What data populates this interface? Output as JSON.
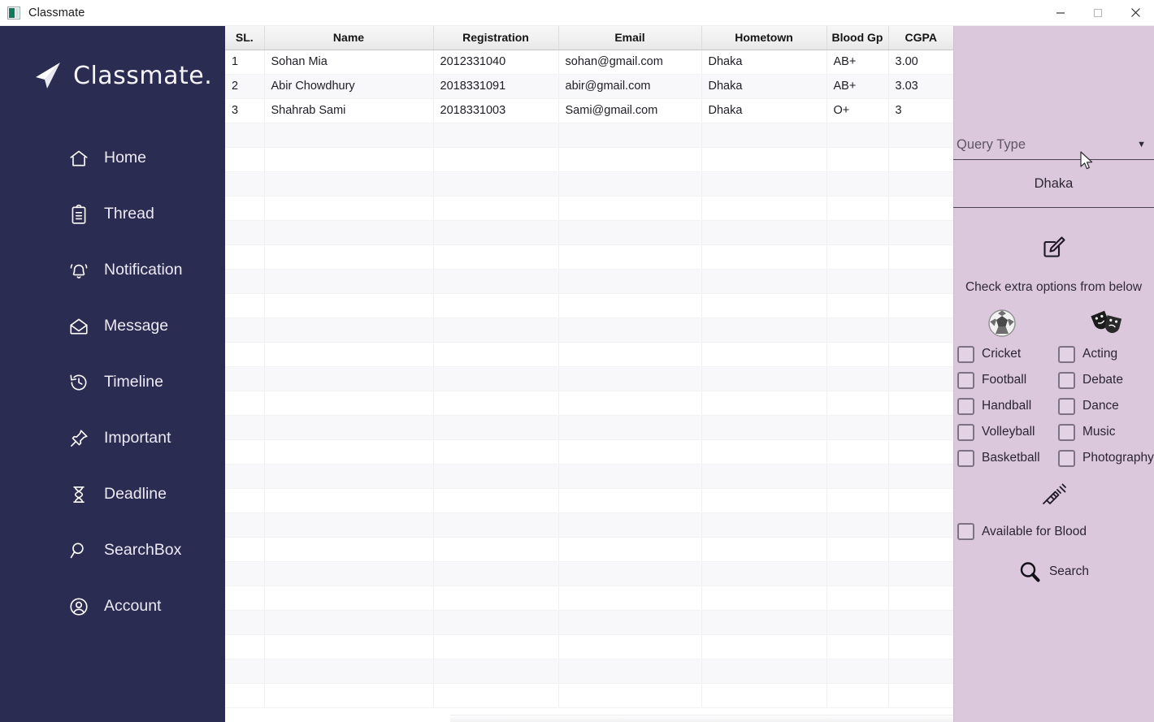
{
  "window": {
    "title": "Classmate",
    "icon": "app-icon",
    "controls": {
      "minimize": "minimize",
      "maximize": "maximize",
      "close": "close"
    }
  },
  "brand": {
    "name": "Classmate.",
    "icon": "paper-plane-icon"
  },
  "sidebar": {
    "background": "#2b2c52",
    "items": [
      {
        "label": "Home",
        "icon": "home-icon"
      },
      {
        "label": "Thread",
        "icon": "clipboard-icon"
      },
      {
        "label": "Notification",
        "icon": "bell-icon"
      },
      {
        "label": "Message",
        "icon": "envelope-icon"
      },
      {
        "label": "Timeline",
        "icon": "clock-history-icon"
      },
      {
        "label": "Important",
        "icon": "pin-icon"
      },
      {
        "label": "Deadline",
        "icon": "hourglass-icon"
      },
      {
        "label": "SearchBox",
        "icon": "magnifier-icon"
      },
      {
        "label": "Account",
        "icon": "account-circle-icon"
      }
    ]
  },
  "table": {
    "columns": [
      "SL.",
      "Name",
      "Registration",
      "Email",
      "Hometown",
      "Blood Gp",
      "CGPA"
    ],
    "rows": [
      {
        "sl": "1",
        "name": "Sohan Mia",
        "registration": "2012331040",
        "email": "sohan@gmail.com",
        "hometown": "Dhaka",
        "blood": "AB+",
        "cgpa": "3.00"
      },
      {
        "sl": "2",
        "name": "Abir Chowdhury",
        "registration": "2018331091",
        "email": "abir@gmail.com",
        "hometown": "Dhaka",
        "blood": "AB+",
        "cgpa": "3.03"
      },
      {
        "sl": "3",
        "name": "Shahrab Sami",
        "registration": "2018331003",
        "email": "Sami@gmail.com",
        "hometown": "Dhaka",
        "blood": "O+",
        "cgpa": "3"
      }
    ],
    "empty_row_count": 24
  },
  "panel": {
    "background": "#dcc8dd",
    "query_type": {
      "label": "Query Type",
      "caret": "chevron-down-icon"
    },
    "query_value": "Dhaka",
    "edit_icon": "edit-square-icon",
    "hint": "Check extra options from below",
    "category_icons": {
      "sports": "soccer-ball-icon",
      "arts": "theater-masks-icon"
    },
    "sports_options": [
      {
        "label": "Cricket",
        "checked": false
      },
      {
        "label": "Football",
        "checked": false
      },
      {
        "label": "Handball",
        "checked": false
      },
      {
        "label": "Volleyball",
        "checked": false
      },
      {
        "label": "Basketball",
        "checked": false
      }
    ],
    "arts_options": [
      {
        "label": "Acting",
        "checked": false
      },
      {
        "label": "Debate",
        "checked": false
      },
      {
        "label": "Dance",
        "checked": false
      },
      {
        "label": "Music",
        "checked": false
      },
      {
        "label": "Photography",
        "checked": false
      }
    ],
    "blood": {
      "icon": "syringe-icon",
      "label": "Available for Blood",
      "checked": false
    },
    "search": {
      "label": "Search",
      "icon": "magnifier-icon"
    }
  }
}
